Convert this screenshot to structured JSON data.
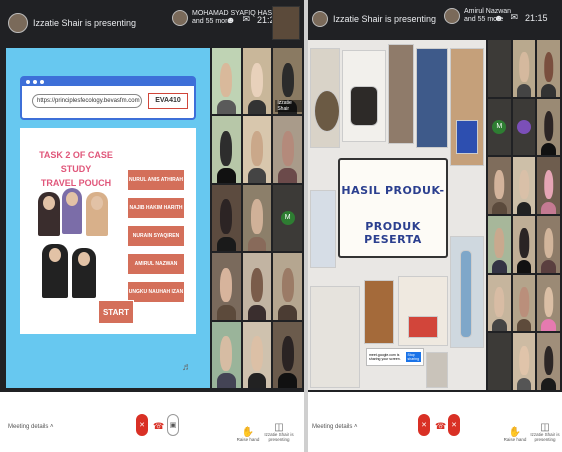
{
  "left": {
    "presenter_text": "Izzatie Shair is presenting",
    "name_chip": "MOHAMAD SYAFIQ HAS...",
    "name_chip_sub": "and 55 more",
    "clock": "21:22",
    "url": "https://principlesfecology.bevasfm.com",
    "code": "EVA410",
    "slide_title_line1": "TASK 2 OF CASE STUDY",
    "slide_title_line2": "TRAVEL POUCH",
    "names": [
      "NURUL ANIS ATHIRAH",
      "NAJIB HAKIM HARITH",
      "NURAIN SYAQIREN",
      "AMIRUL NAZWAN",
      "UNGKU NAUHAH IZAN"
    ],
    "start_label": "START",
    "tile_label": "Izzatie Shair",
    "m_letter": "M",
    "meeting_details": "Meeting details",
    "raise_hand": "Raise hand",
    "presenting_label": "Izzatie Shair is presenting"
  },
  "right": {
    "presenter_text": "Izzatie Shair is presenting",
    "name_chip": "Amirul Nazwan",
    "name_chip_sub": "and 55 more",
    "clock": "21:15",
    "title_line1": "HASIL PRODUK-",
    "title_line2": "PRODUK  PESERTA",
    "dialog_text": "meet.google.com is sharing your screen.",
    "dialog_button": "Stop sharing",
    "m_letter": "M",
    "meeting_details": "Meeting details",
    "raise_hand": "Raise hand",
    "presenting_label": "Izzatie Shair is presenting"
  },
  "icons": {
    "mic_off": "mic-off-icon",
    "camera_off": "camera-off-icon",
    "hangup": "hangup-icon",
    "raise_hand": "hand-icon",
    "present": "present-icon",
    "chevron": "chevron-up-icon"
  },
  "colors": {
    "meet_red": "#d93025",
    "slide_blue": "#67c8f0",
    "name_button": "#d46f5a",
    "title_pink": "#e0567a",
    "board_blue": "#2b3f8f"
  }
}
